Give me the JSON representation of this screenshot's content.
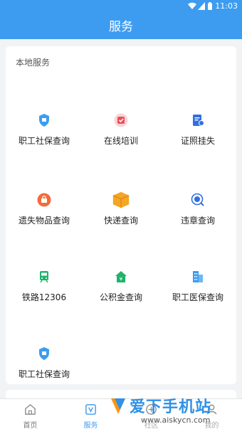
{
  "status_bar": {
    "time": "11:03"
  },
  "header": {
    "title": "服务"
  },
  "section": {
    "title": "本地服务",
    "items": [
      {
        "label": "职工社保查询",
        "icon": "shield-icon",
        "color": "#3d9cf0"
      },
      {
        "label": "在线培训",
        "icon": "training-icon",
        "color": "#e8505b"
      },
      {
        "label": "证照挂失",
        "icon": "document-icon",
        "color": "#2f6fe0"
      },
      {
        "label": "遗失物品查询",
        "icon": "lost-item-icon",
        "color": "#f26b3a"
      },
      {
        "label": "快递查询",
        "icon": "package-icon",
        "color": "#f5a623"
      },
      {
        "label": "违章查询",
        "icon": "violation-icon",
        "color": "#2f6fe0"
      },
      {
        "label": "铁路12306",
        "icon": "train-icon",
        "color": "#1fb36b"
      },
      {
        "label": "公积金查询",
        "icon": "house-fund-icon",
        "color": "#1fb36b"
      },
      {
        "label": "职工医保查询",
        "icon": "building-icon",
        "color": "#3d9cf0"
      },
      {
        "label": "职工社保查询",
        "icon": "shield-icon",
        "color": "#3d9cf0"
      }
    ]
  },
  "tabs": [
    {
      "label": "首页",
      "icon": "home-icon",
      "active": false
    },
    {
      "label": "服务",
      "icon": "services-icon",
      "active": true
    },
    {
      "label": "社区",
      "icon": "community-icon",
      "active": false
    },
    {
      "label": "我的",
      "icon": "profile-icon",
      "active": false
    }
  ],
  "watermark": {
    "text": "爱下手机站",
    "url": "www.aiskycn.com"
  }
}
